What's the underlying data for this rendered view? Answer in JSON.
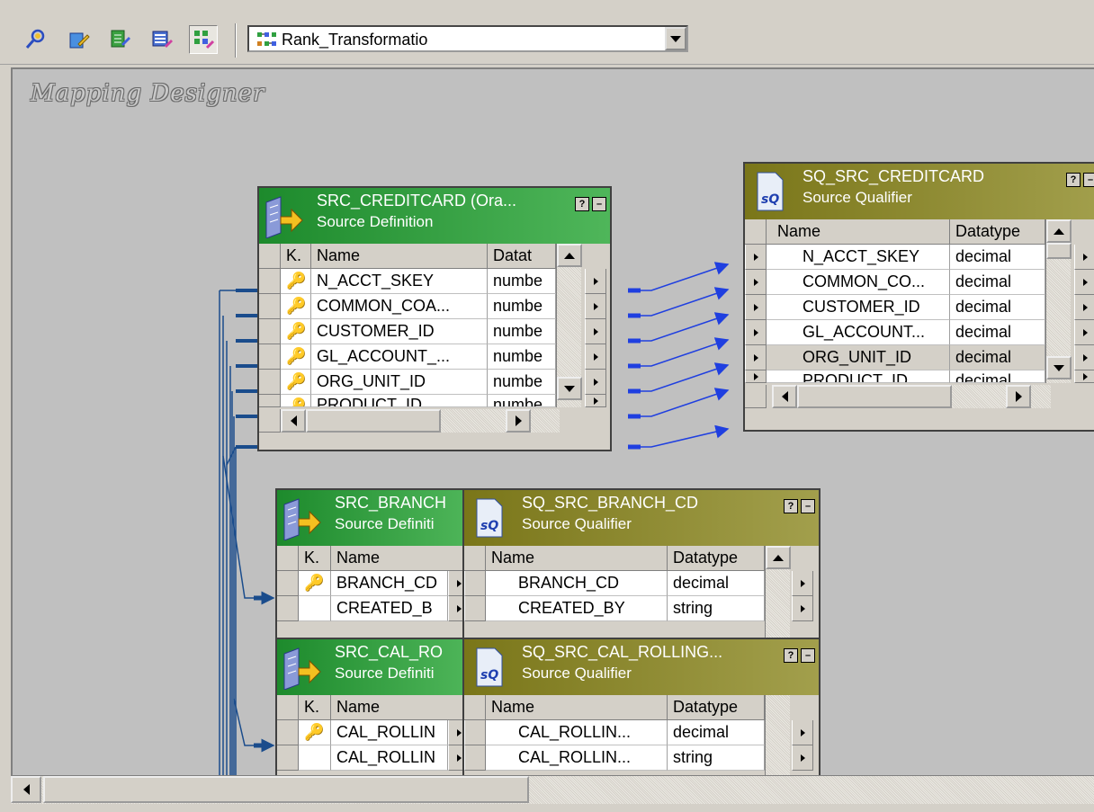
{
  "toolbar": {
    "buttons": [
      {
        "name": "source-analyzer-icon"
      },
      {
        "name": "target-designer-icon"
      },
      {
        "name": "transformation-developer-icon"
      },
      {
        "name": "mapplet-designer-icon"
      },
      {
        "name": "mapping-designer-icon",
        "pressed": true
      }
    ],
    "mapping_select": {
      "value": "Rank_Transformatio"
    }
  },
  "canvas": {
    "title": "Mapping Designer"
  },
  "transformations": {
    "src_creditcard": {
      "title": "SRC_CREDITCARD (Ora...",
      "subtitle": "Source Definition",
      "headers": {
        "key": "K.",
        "name": "Name",
        "datatype": "Datat"
      },
      "rows": [
        {
          "name": "N_ACCT_SKEY",
          "datatype": "numbe"
        },
        {
          "name": "COMMON_COA...",
          "datatype": "numbe"
        },
        {
          "name": "CUSTOMER_ID",
          "datatype": "numbe"
        },
        {
          "name": "GL_ACCOUNT_...",
          "datatype": "numbe"
        },
        {
          "name": "ORG_UNIT_ID",
          "datatype": "numbe"
        },
        {
          "name": "PRODUCT_ID",
          "datatype": "numbe"
        }
      ]
    },
    "sq_src_creditcard": {
      "title": "SQ_SRC_CREDITCARD",
      "subtitle": "Source Qualifier",
      "headers": {
        "name": "Name",
        "datatype": "Datatype"
      },
      "rows": [
        {
          "name": "N_ACCT_SKEY",
          "datatype": "decimal"
        },
        {
          "name": "COMMON_CO...",
          "datatype": "decimal"
        },
        {
          "name": "CUSTOMER_ID",
          "datatype": "decimal"
        },
        {
          "name": "GL_ACCOUNT...",
          "datatype": "decimal"
        },
        {
          "name": "ORG_UNIT_ID",
          "datatype": "decimal"
        },
        {
          "name": "PRODUCT_ID",
          "datatype": "decimal"
        }
      ]
    },
    "src_branch": {
      "title": "SRC_BRANCH",
      "subtitle": "Source Definiti",
      "headers": {
        "key": "K.",
        "name": "Name"
      },
      "rows": [
        {
          "name": "BRANCH_CD"
        },
        {
          "name": "CREATED_B"
        }
      ]
    },
    "sq_src_branch": {
      "title": "SQ_SRC_BRANCH_CD",
      "subtitle": "Source Qualifier",
      "headers": {
        "name": "Name",
        "datatype": "Datatype"
      },
      "rows": [
        {
          "name": "BRANCH_CD",
          "datatype": "decimal"
        },
        {
          "name": "CREATED_BY",
          "datatype": "string"
        }
      ]
    },
    "src_cal": {
      "title": "SRC_CAL_RO",
      "subtitle": "Source Definiti",
      "headers": {
        "key": "K.",
        "name": "Name"
      },
      "rows": [
        {
          "name": "CAL_ROLLIN"
        },
        {
          "name": "CAL_ROLLIN"
        }
      ]
    },
    "sq_src_cal": {
      "title": "SQ_SRC_CAL_ROLLING...",
      "subtitle": "Source Qualifier",
      "headers": {
        "name": "Name",
        "datatype": "Datatype"
      },
      "rows": [
        {
          "name": "CAL_ROLLIN...",
          "datatype": "decimal"
        },
        {
          "name": "CAL_ROLLIN...",
          "datatype": "string"
        }
      ]
    }
  },
  "colors": {
    "source_definition_header": "#2e9a3c",
    "source_qualifier_header": "#8a8630",
    "link_arrow": "#1f3fe0",
    "link_line_dark": "#1a4c8c"
  }
}
